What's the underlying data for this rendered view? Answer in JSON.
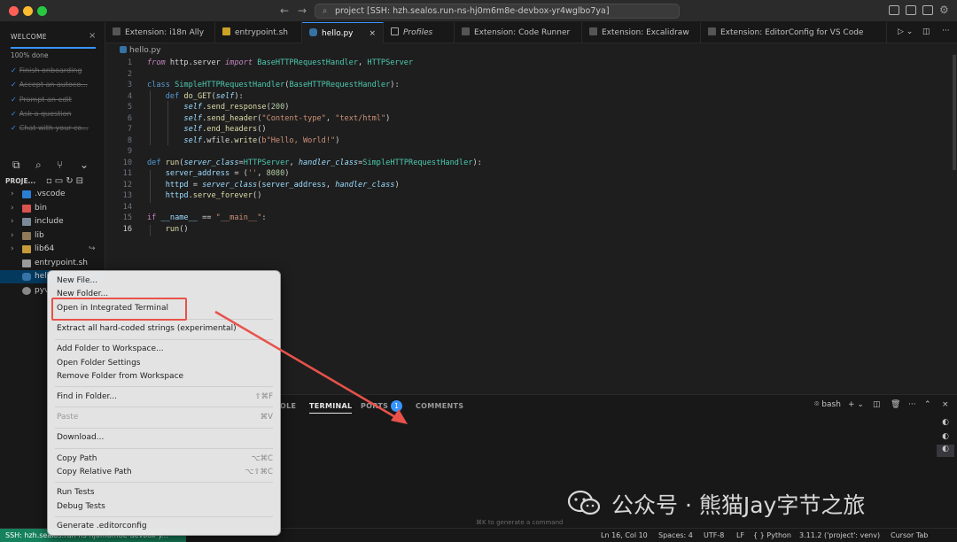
{
  "window": {
    "search_text": "project [SSH: hzh.sealos.run-ns-hj0m6m8e-devbox-yr4wglbo7ya]"
  },
  "welcome": {
    "header": "WELCOME",
    "progress_label": "100% done",
    "progress_fraction": 1.0,
    "items": [
      "Finish onboarding",
      "Accept an autoco...",
      "Prompt an edit",
      "Ask a question",
      "Chat with your co..."
    ]
  },
  "explorer": {
    "header": "PROJE...",
    "items": [
      {
        "name": ".vscode",
        "kind": "folder"
      },
      {
        "name": "bin",
        "kind": "folder"
      },
      {
        "name": "include",
        "kind": "folder"
      },
      {
        "name": "lib",
        "kind": "folder"
      },
      {
        "name": "lib64",
        "kind": "folder"
      },
      {
        "name": "entrypoint.sh",
        "kind": "file"
      },
      {
        "name": "hell",
        "kind": "file"
      },
      {
        "name": "pyv",
        "kind": "file"
      }
    ]
  },
  "tabs": [
    {
      "label": "Extension: i18n Ally"
    },
    {
      "label": "entrypoint.sh"
    },
    {
      "label": "hello.py",
      "active": true
    },
    {
      "label": "Profiles"
    },
    {
      "label": "Extension: Code Runner"
    },
    {
      "label": "Extension: Excalidraw"
    },
    {
      "label": "Extension: EditorConfig for VS Code"
    }
  ],
  "breadcrumb": "hello.py",
  "editor": {
    "line_numbers": [
      "1",
      "2",
      "3",
      "4",
      "5",
      "6",
      "7",
      "8",
      "9",
      "10",
      "11",
      "12",
      "13",
      "14",
      "15",
      "16"
    ]
  },
  "panel": {
    "tabs": [
      "OLE",
      "TERMINAL",
      "PORTS",
      "COMMENTS"
    ],
    "ports_badge": "1",
    "shell": "bash",
    "hint": "⌘K to generate a command"
  },
  "context_menu": {
    "items": [
      {
        "label": "New File..."
      },
      {
        "label": "New Folder..."
      },
      {
        "label": "Open in Integrated Terminal"
      },
      {
        "label": "Extract all hard-coded strings (experimental)"
      },
      {
        "label": "Add Folder to Workspace..."
      },
      {
        "label": "Open Folder Settings"
      },
      {
        "label": "Remove Folder from Workspace"
      },
      {
        "label": "Find in Folder...",
        "shortcut": "⇧⌘F"
      },
      {
        "label": "Paste",
        "shortcut": "⌘V",
        "disabled": true
      },
      {
        "label": "Download..."
      },
      {
        "label": "Copy Path",
        "shortcut": "⌥⌘C"
      },
      {
        "label": "Copy Relative Path",
        "shortcut": "⌥⇧⌘C"
      },
      {
        "label": "Run Tests"
      },
      {
        "label": "Debug Tests"
      },
      {
        "label": "Generate .editorconfig"
      }
    ]
  },
  "statusbar": {
    "remote": "SSH: hzh.sealos.run-ns-hj0m6m8e-devbox-y...",
    "items": [
      "Ln 16, Col 10",
      "Spaces: 4",
      "UTF-8",
      "LF",
      "{ } Python",
      "3.11.2 ('project': venv)",
      "Cursor Tab"
    ]
  },
  "watermark": {
    "text": "公众号 · 熊猫Jay字节之旅"
  },
  "colors": {
    "accent": "#3794ff",
    "remote_bg": "#16825d",
    "highlight": "#e8524a"
  }
}
